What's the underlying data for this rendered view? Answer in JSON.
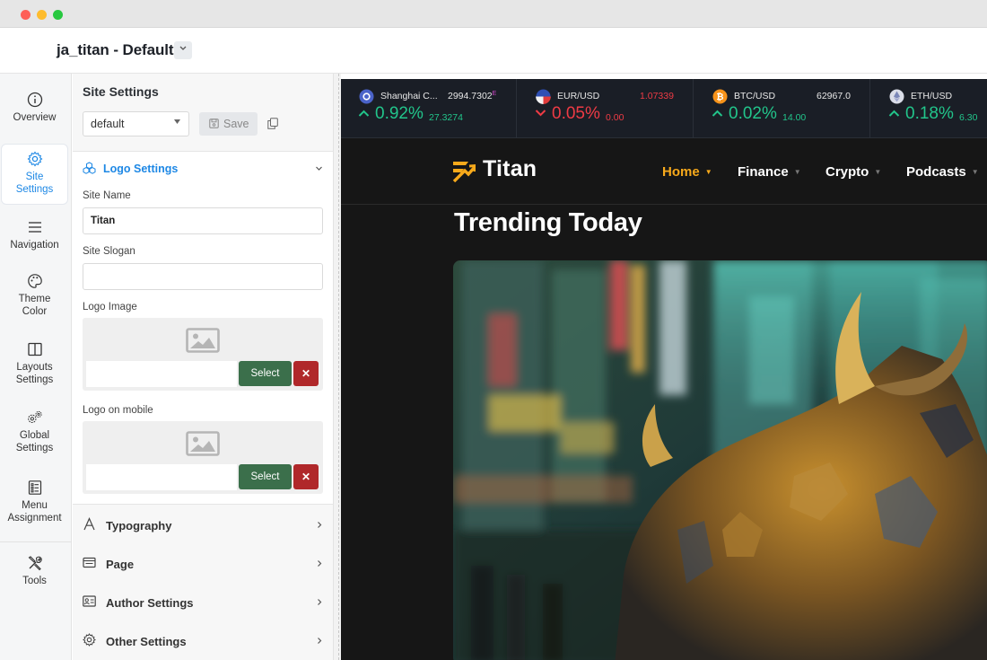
{
  "app": {
    "title": "ja_titan - Default"
  },
  "leftnav": {
    "items": [
      {
        "label": "Overview",
        "icon": "info-icon"
      },
      {
        "label": "Site\nSettings",
        "icon": "gear-icon",
        "active": true
      },
      {
        "label": "Navigation",
        "icon": "menu-icon"
      },
      {
        "label": "Theme\nColor",
        "icon": "palette-icon"
      },
      {
        "label": "Layouts\nSettings",
        "icon": "layout-icon"
      },
      {
        "label": "Global\nSettings",
        "icon": "gears-icon"
      },
      {
        "label": "Menu\nAssignment",
        "icon": "list-icon"
      },
      {
        "label": "Tools",
        "icon": "tools-icon"
      }
    ]
  },
  "panel": {
    "title": "Site Settings",
    "style_select": "default",
    "save_label": "Save",
    "logo_settings": {
      "header": "Logo Settings",
      "site_name_label": "Site Name",
      "site_name_value": "Titan",
      "site_slogan_label": "Site Slogan",
      "site_slogan_value": "",
      "logo_image_label": "Logo Image",
      "logo_mobile_label": "Logo on mobile",
      "select_label": "Select",
      "clear_label": "✕"
    },
    "sections": [
      {
        "label": "Typography",
        "icon": "font-icon"
      },
      {
        "label": "Page",
        "icon": "page-icon"
      },
      {
        "label": "Author Settings",
        "icon": "id-card-icon"
      },
      {
        "label": "Other Settings",
        "icon": "gear-icon"
      }
    ]
  },
  "preview": {
    "ticker": [
      {
        "name": "Shanghai C...",
        "price": "2994.7302",
        "price_marker": "E",
        "pct": "0.92%",
        "change": "27.3274",
        "direction": "up",
        "price_color": "#e8e8e8",
        "coin": "shanghai-icon"
      },
      {
        "name": "EUR/USD",
        "price": "1.07339",
        "pct": "0.05%",
        "change": "0.00",
        "direction": "down",
        "price_color": "#ef3b45",
        "coin": "eur-flag-icon"
      },
      {
        "name": "BTC/USD",
        "price": "62967.0",
        "pct": "0.02%",
        "change": "14.00",
        "direction": "up",
        "price_color": "#e8e8e8",
        "coin": "bitcoin-icon"
      },
      {
        "name": "ETH/USD",
        "price": "",
        "pct": "0.18%",
        "change": "6.30",
        "direction": "up",
        "price_color": "#e8e8e8",
        "coin": "ethereum-icon"
      }
    ],
    "brand": "Titan",
    "menu": [
      {
        "label": "Home",
        "active": true
      },
      {
        "label": "Finance",
        "active": false
      },
      {
        "label": "Crypto",
        "active": false
      },
      {
        "label": "Podcasts",
        "active": false
      }
    ],
    "heading": "Trending Today"
  },
  "colors": {
    "accent": "#1e88e5",
    "nav_active": "#f7a91b",
    "up": "#22c58b",
    "down": "#ef3b45",
    "select_btn": "#3b6f4b",
    "clear_btn": "#b0282a"
  }
}
